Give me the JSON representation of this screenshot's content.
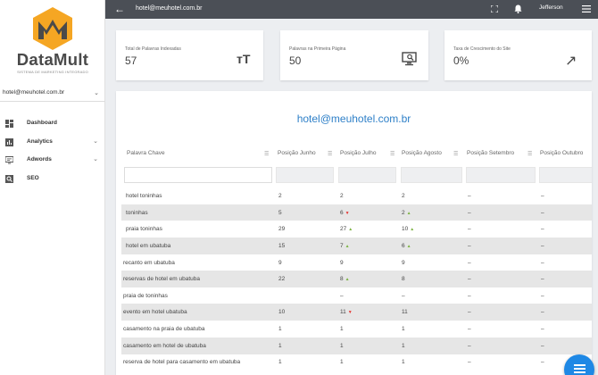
{
  "brand": {
    "name": "DataMult",
    "tagline": "SISTEMA DE MARKETING INTEGRADO",
    "accent": "#f5a623"
  },
  "sidebar": {
    "account": "hotel@meuhotel.com.br",
    "items": [
      {
        "label": "Dashboard",
        "icon": "dashboard-icon"
      },
      {
        "label": "Analytics",
        "icon": "bar-chart-icon"
      },
      {
        "label": "Adwords",
        "icon": "monitor-icon"
      },
      {
        "label": "SEO",
        "icon": "search-icon"
      }
    ]
  },
  "topbar": {
    "title": "hotel@meuhotel.com.br",
    "user": "Jefferson",
    "back_glyph": "←"
  },
  "cards": [
    {
      "label": "Total de Palavras Indexadas",
      "value": "57",
      "icon": "text-size-icon",
      "glyph": "ᴛT"
    },
    {
      "label": "Palavras na Primeira Página",
      "value": "50",
      "icon": "desktop-search-icon",
      "glyph": ""
    },
    {
      "label": "Taxa de Crescimento do Site",
      "value": "0%",
      "icon": "arrow-up-right-icon",
      "glyph": "↗"
    }
  ],
  "panel": {
    "title": "hotel@meuhotel.com.br",
    "columns": [
      "Palavra Chave",
      "Posição Junho",
      "Posição Julho",
      "Posição Agosto",
      "Posição Setembro",
      "Posição Outubro"
    ],
    "rows": [
      {
        "kw": "hotel toninhas",
        "jun": "2",
        "jul": "2",
        "jul_t": "",
        "ago": "2",
        "ago_t": "",
        "set": "–",
        "out": "–"
      },
      {
        "kw": "toninhas",
        "jun": "5",
        "jul": "6",
        "jul_t": "▼",
        "ago": "2",
        "ago_t": "▲",
        "set": "–",
        "out": "–"
      },
      {
        "kw": "praia toninhas",
        "jun": "29",
        "jul": "27",
        "jul_t": "▲",
        "ago": "10",
        "ago_t": "▲",
        "set": "–",
        "out": "–"
      },
      {
        "kw": "hotel em ubatuba",
        "jun": "15",
        "jul": "7",
        "jul_t": "▲",
        "ago": "6",
        "ago_t": "▲",
        "set": "–",
        "out": "–"
      },
      {
        "kw": "recanto em ubatuba",
        "jun": "9",
        "jul": "9",
        "jul_t": "",
        "ago": "9",
        "ago_t": "",
        "set": "–",
        "out": "–"
      },
      {
        "kw": "reservas de hotel em ubatuba",
        "jun": "22",
        "jul": "8",
        "jul_t": "▲",
        "ago": "8",
        "ago_t": "",
        "set": "–",
        "out": "–"
      },
      {
        "kw": "praia de toninhas",
        "jun": "",
        "jul": "–",
        "jul_t": "",
        "ago": "–",
        "ago_t": "",
        "set": "–",
        "out": "–"
      },
      {
        "kw": "evento em hotel ubatuba",
        "jun": "10",
        "jul": "11",
        "jul_t": "▼",
        "ago": "11",
        "ago_t": "",
        "set": "–",
        "out": "–"
      },
      {
        "kw": "casamento na praia de ubatuba",
        "jun": "1",
        "jul": "1",
        "jul_t": "",
        "ago": "1",
        "ago_t": "",
        "set": "–",
        "out": "–"
      },
      {
        "kw": "casamento em hotel de ubatuba",
        "jun": "1",
        "jul": "1",
        "jul_t": "",
        "ago": "1",
        "ago_t": "",
        "set": "–",
        "out": "–"
      },
      {
        "kw": "reserva de hotel para casamento em ubatuba",
        "jun": "1",
        "jul": "1",
        "jul_t": "",
        "ago": "1",
        "ago_t": "",
        "set": "–",
        "out": "–"
      }
    ]
  }
}
